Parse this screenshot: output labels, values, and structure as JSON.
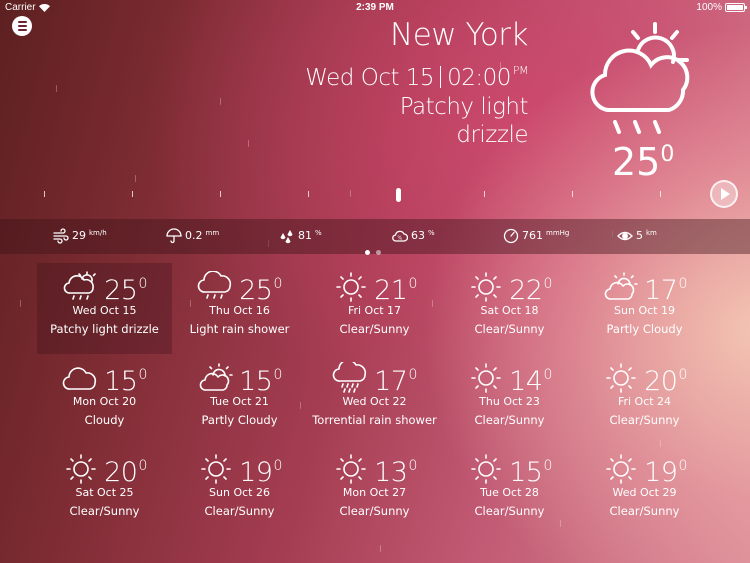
{
  "status_bar": {
    "carrier": "Carrier",
    "time": "2:39 PM",
    "battery": "100%"
  },
  "header": {
    "city": "New York",
    "date": "Wed Oct 15",
    "time": "02:00",
    "ampm": "PM",
    "condition_line1": "Patchy light",
    "condition_line2": "drizzle",
    "current_temp": "25",
    "degree": "0",
    "icon": "cloud-sun-rain-icon"
  },
  "metrics": [
    {
      "name": "wind",
      "icon": "wind-icon",
      "value": "29",
      "unit": "km/h"
    },
    {
      "name": "precipitation",
      "icon": "umbrella-icon",
      "value": "0.2",
      "unit": "mm"
    },
    {
      "name": "humidity",
      "icon": "droplets-icon",
      "value": "81",
      "unit": "%"
    },
    {
      "name": "cloud-cover",
      "icon": "cloud-percent-icon",
      "value": "63",
      "unit": "%"
    },
    {
      "name": "pressure",
      "icon": "gauge-icon",
      "value": "761",
      "unit": "mmHg"
    },
    {
      "name": "visibility",
      "icon": "eye-icon",
      "value": "5",
      "unit": "km"
    }
  ],
  "pager": {
    "pages": 2,
    "active": 0
  },
  "forecast": [
    {
      "temp": "25",
      "date": "Wed Oct 15",
      "desc": "Patchy light drizzle",
      "icon": "drizzle"
    },
    {
      "temp": "25",
      "date": "Thu Oct 16",
      "desc": "Light rain shower",
      "icon": "rain"
    },
    {
      "temp": "21",
      "date": "Fri Oct 17",
      "desc": "Clear/Sunny",
      "icon": "sun"
    },
    {
      "temp": "22",
      "date": "Sat Oct 18",
      "desc": "Clear/Sunny",
      "icon": "sun"
    },
    {
      "temp": "17",
      "date": "Sun Oct 19",
      "desc": "Partly Cloudy",
      "icon": "partly"
    },
    {
      "temp": "15",
      "date": "Mon Oct 20",
      "desc": "Cloudy",
      "icon": "cloudy"
    },
    {
      "temp": "15",
      "date": "Tue Oct 21",
      "desc": "Partly Cloudy",
      "icon": "partly"
    },
    {
      "temp": "17",
      "date": "Wed Oct 22",
      "desc": "Torrential rain shower",
      "icon": "heavyrain"
    },
    {
      "temp": "14",
      "date": "Thu Oct 23",
      "desc": "Clear/Sunny",
      "icon": "sun"
    },
    {
      "temp": "20",
      "date": "Fri Oct 24",
      "desc": "Clear/Sunny",
      "icon": "sun"
    },
    {
      "temp": "20",
      "date": "Sat Oct 25",
      "desc": "Clear/Sunny",
      "icon": "sun"
    },
    {
      "temp": "19",
      "date": "Sun Oct 26",
      "desc": "Clear/Sunny",
      "icon": "sun"
    },
    {
      "temp": "13",
      "date": "Mon Oct 27",
      "desc": "Clear/Sunny",
      "icon": "sun"
    },
    {
      "temp": "15",
      "date": "Tue Oct 28",
      "desc": "Clear/Sunny",
      "icon": "sun"
    },
    {
      "temp": "19",
      "date": "Wed Oct 29",
      "desc": "Clear/Sunny",
      "icon": "sun"
    }
  ]
}
